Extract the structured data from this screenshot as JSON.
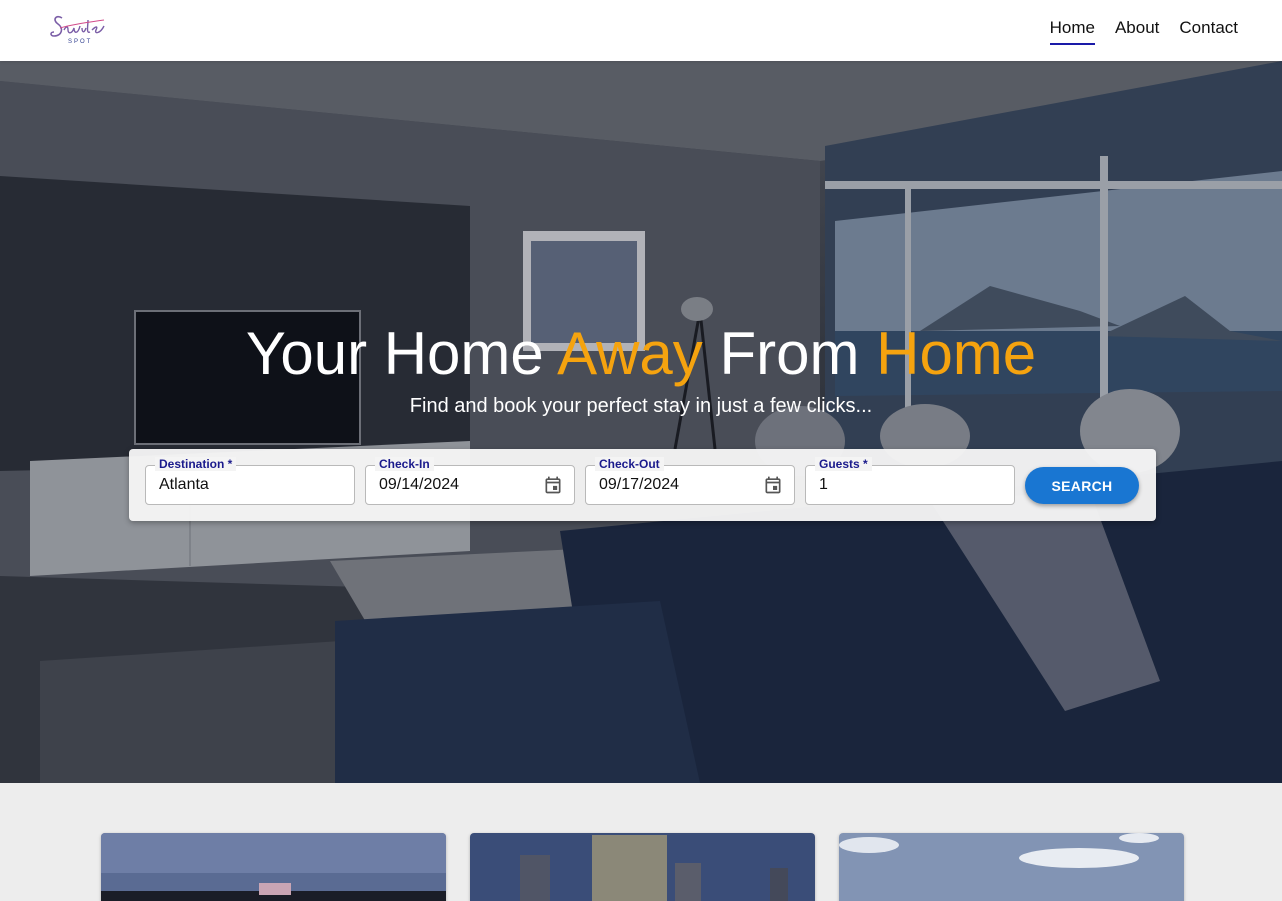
{
  "brand": {
    "logo_text": "Suite Spot"
  },
  "nav": {
    "items": [
      {
        "label": "Home",
        "active": true
      },
      {
        "label": "About",
        "active": false
      },
      {
        "label": "Contact",
        "active": false
      }
    ]
  },
  "hero": {
    "title_part1": "Your Home ",
    "title_accent1": "Away",
    "title_part2": " From ",
    "title_accent2": "Home",
    "subtitle": "Find and book your perfect stay in just a few clicks...",
    "accent_color": "#f5a30f"
  },
  "search": {
    "destination": {
      "label": "Destination *",
      "value": "Atlanta"
    },
    "check_in": {
      "label": "Check-In",
      "value": "09/14/2024"
    },
    "check_out": {
      "label": "Check-Out",
      "value": "09/17/2024"
    },
    "guests": {
      "label": "Guests *",
      "value": "1"
    },
    "button_label": "SEARCH",
    "button_color": "#1976d2"
  }
}
